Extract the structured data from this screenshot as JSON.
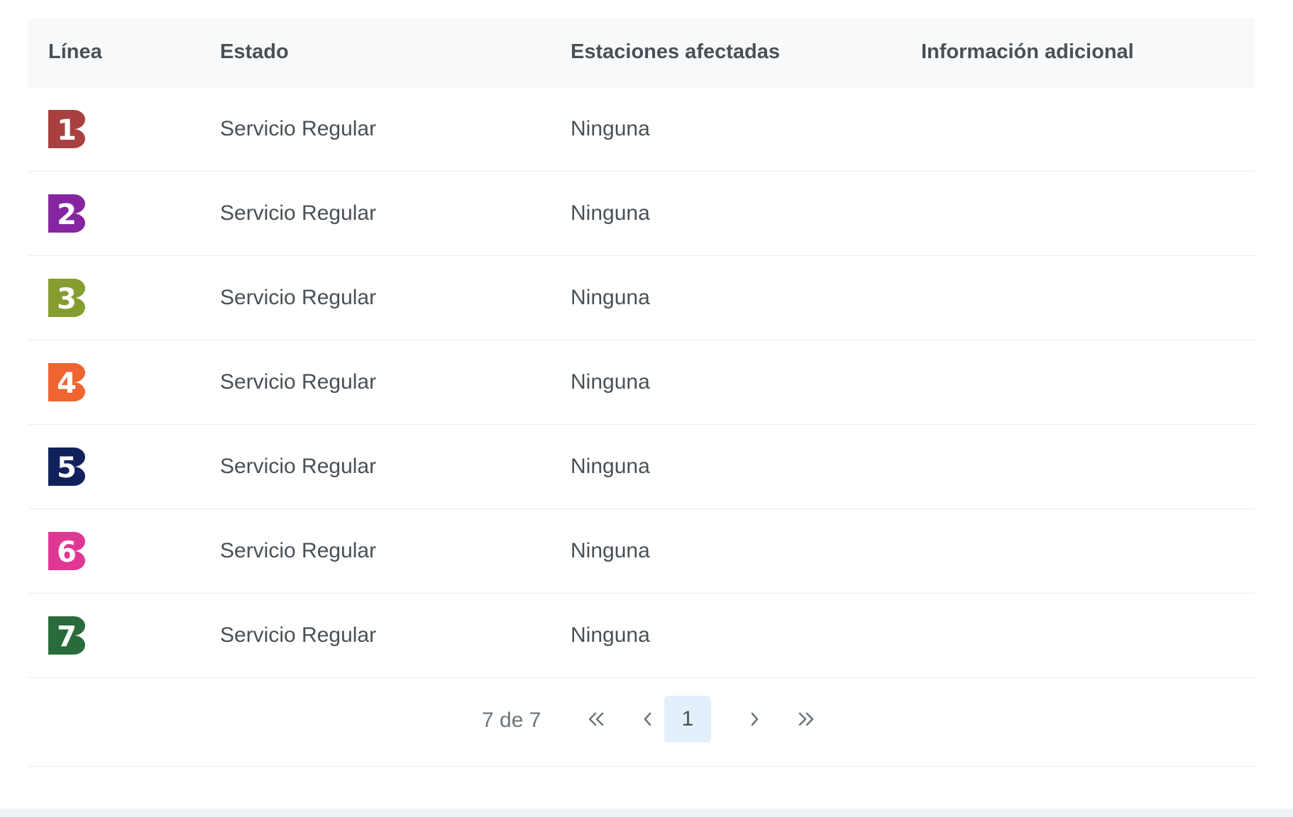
{
  "table": {
    "headers": {
      "line": "Línea",
      "state": "Estado",
      "stations": "Estaciones afectadas",
      "info": "Información adicional"
    },
    "rows": [
      {
        "line": "1",
        "color": "#a8403f",
        "state": "Servicio Regular",
        "stations": "Ninguna",
        "info": ""
      },
      {
        "line": "2",
        "color": "#8526a0",
        "state": "Servicio Regular",
        "stations": "Ninguna",
        "info": ""
      },
      {
        "line": "3",
        "color": "#849d2e",
        "state": "Servicio Regular",
        "stations": "Ninguna",
        "info": ""
      },
      {
        "line": "4",
        "color": "#ef6430",
        "state": "Servicio Regular",
        "stations": "Ninguna",
        "info": ""
      },
      {
        "line": "5",
        "color": "#11215c",
        "state": "Servicio Regular",
        "stations": "Ninguna",
        "info": ""
      },
      {
        "line": "6",
        "color": "#df3894",
        "state": "Servicio Regular",
        "stations": "Ninguna",
        "info": ""
      },
      {
        "line": "7",
        "color": "#2a6b3c",
        "state": "Servicio Regular",
        "stations": "Ninguna",
        "info": ""
      }
    ]
  },
  "pagination": {
    "report": "7 de 7",
    "current_page": "1",
    "icons": {
      "first": "double-chevron-left-icon",
      "prev": "chevron-left-icon",
      "next": "chevron-right-icon",
      "last": "double-chevron-right-icon"
    }
  },
  "colors": {
    "header_bg": "#f8f9fa",
    "active_page_bg": "#e3f0fc",
    "text": "#495057",
    "muted": "#6c757d"
  }
}
